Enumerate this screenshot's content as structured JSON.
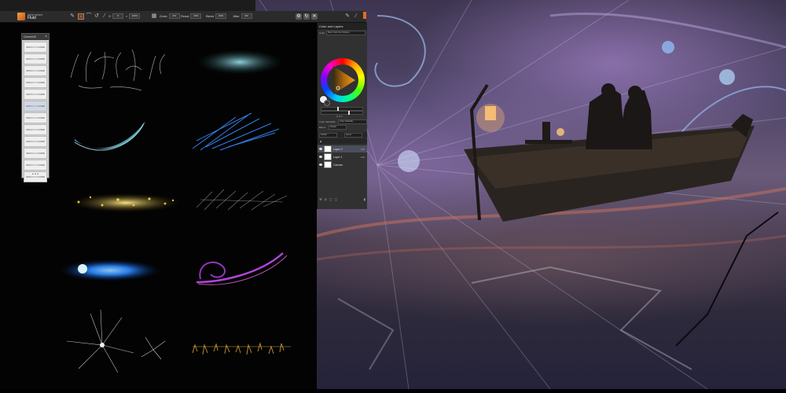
{
  "toolbar": {
    "brush_category": "Airbrushes",
    "brush_name": "Fluid",
    "size_label": "Size",
    "size_value": "9",
    "opacity_value": "100%",
    "grain_label": "Grain",
    "grain_value": "0%",
    "resat_label": "Resat",
    "resat_value": "30%",
    "bleed_label": "Bleed",
    "bleed_value": "80%",
    "jitter_label": "Jitter",
    "jitter_value": "0%"
  },
  "brush_panel": {
    "title": "Current M",
    "row_count": 14,
    "footer": "• • •"
  },
  "color_panel": {
    "title": "Color and Layers",
    "sub_label": "Color",
    "sub_value": "Mixer Color Set Libraries",
    "hsv_label": "H S V",
    "color_variability_label": "Color Variability",
    "color_variability_value": "Color Variability",
    "blend_label": "Blend",
    "blend_value": "Default",
    "composite_label": "Default",
    "composite_value": "Ignore",
    "accent_color": "#e46b25"
  },
  "layers": [
    {
      "name": "Layer 2",
      "opacity": "100",
      "selected": true
    },
    {
      "name": "Layer 1",
      "opacity": "100",
      "selected": false
    },
    {
      "name": "Canvas",
      "opacity": "",
      "selected": false
    }
  ],
  "icons": [
    "brush-tool-icon",
    "eyedropper-icon",
    "grid-icon",
    "lock-icon",
    "eye-icon",
    "wrench-icon",
    "trash-icon"
  ]
}
